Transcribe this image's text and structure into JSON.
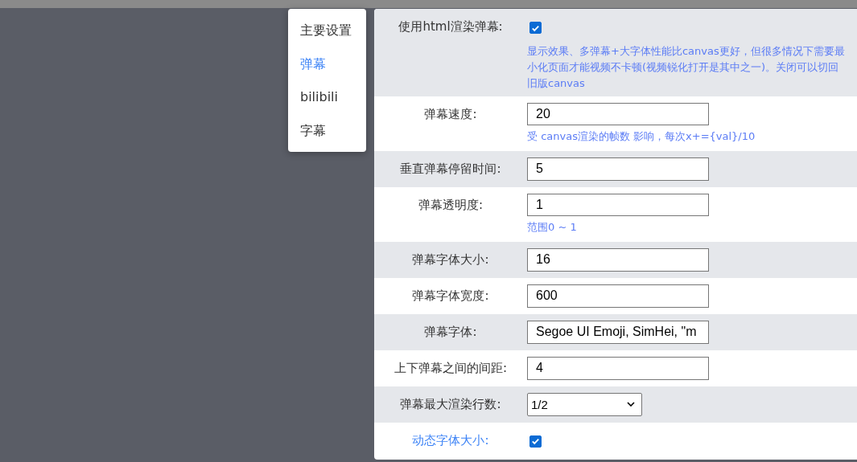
{
  "menu": [
    {
      "label": "主要设置",
      "selected": false
    },
    {
      "label": "弹幕",
      "selected": true
    },
    {
      "label": "bilibili",
      "selected": false
    },
    {
      "label": "字幕",
      "selected": false
    }
  ],
  "settings": [
    {
      "kind": "checkbox",
      "label": "使用html渲染弹幕:",
      "highlighted": false,
      "checked": true,
      "hint": "显示效果、多弹幕+大字体性能比canvas更好，但很多情况下需要最小化页面才能视频不卡顿(视频锐化打开是其中之一)。关闭可以切回旧版canvas"
    },
    {
      "kind": "input",
      "label": "弹幕速度:",
      "highlighted": false,
      "value": "20",
      "hint": "受 canvas渲染的帧数 影响，每次x+={val}/10"
    },
    {
      "kind": "input",
      "label": "垂直弹幕停留时间:",
      "highlighted": false,
      "value": "5"
    },
    {
      "kind": "input",
      "label": "弹幕透明度:",
      "highlighted": false,
      "value": "1",
      "hint": "范围0 ~ 1"
    },
    {
      "kind": "input",
      "label": "弹幕字体大小:",
      "highlighted": false,
      "value": "16"
    },
    {
      "kind": "input",
      "label": "弹幕字体宽度:",
      "highlighted": false,
      "value": "600"
    },
    {
      "kind": "input",
      "label": "弹幕字体:",
      "highlighted": false,
      "value": "Segoe UI Emoji, SimHei, \"m"
    },
    {
      "kind": "input",
      "label": "上下弹幕之间的间距:",
      "highlighted": false,
      "value": "4"
    },
    {
      "kind": "select",
      "label": "弹幕最大渲染行数:",
      "highlighted": false,
      "value": "1/2"
    },
    {
      "kind": "checkbox",
      "label": "动态字体大小:",
      "highlighted": true,
      "checked": true
    }
  ]
}
